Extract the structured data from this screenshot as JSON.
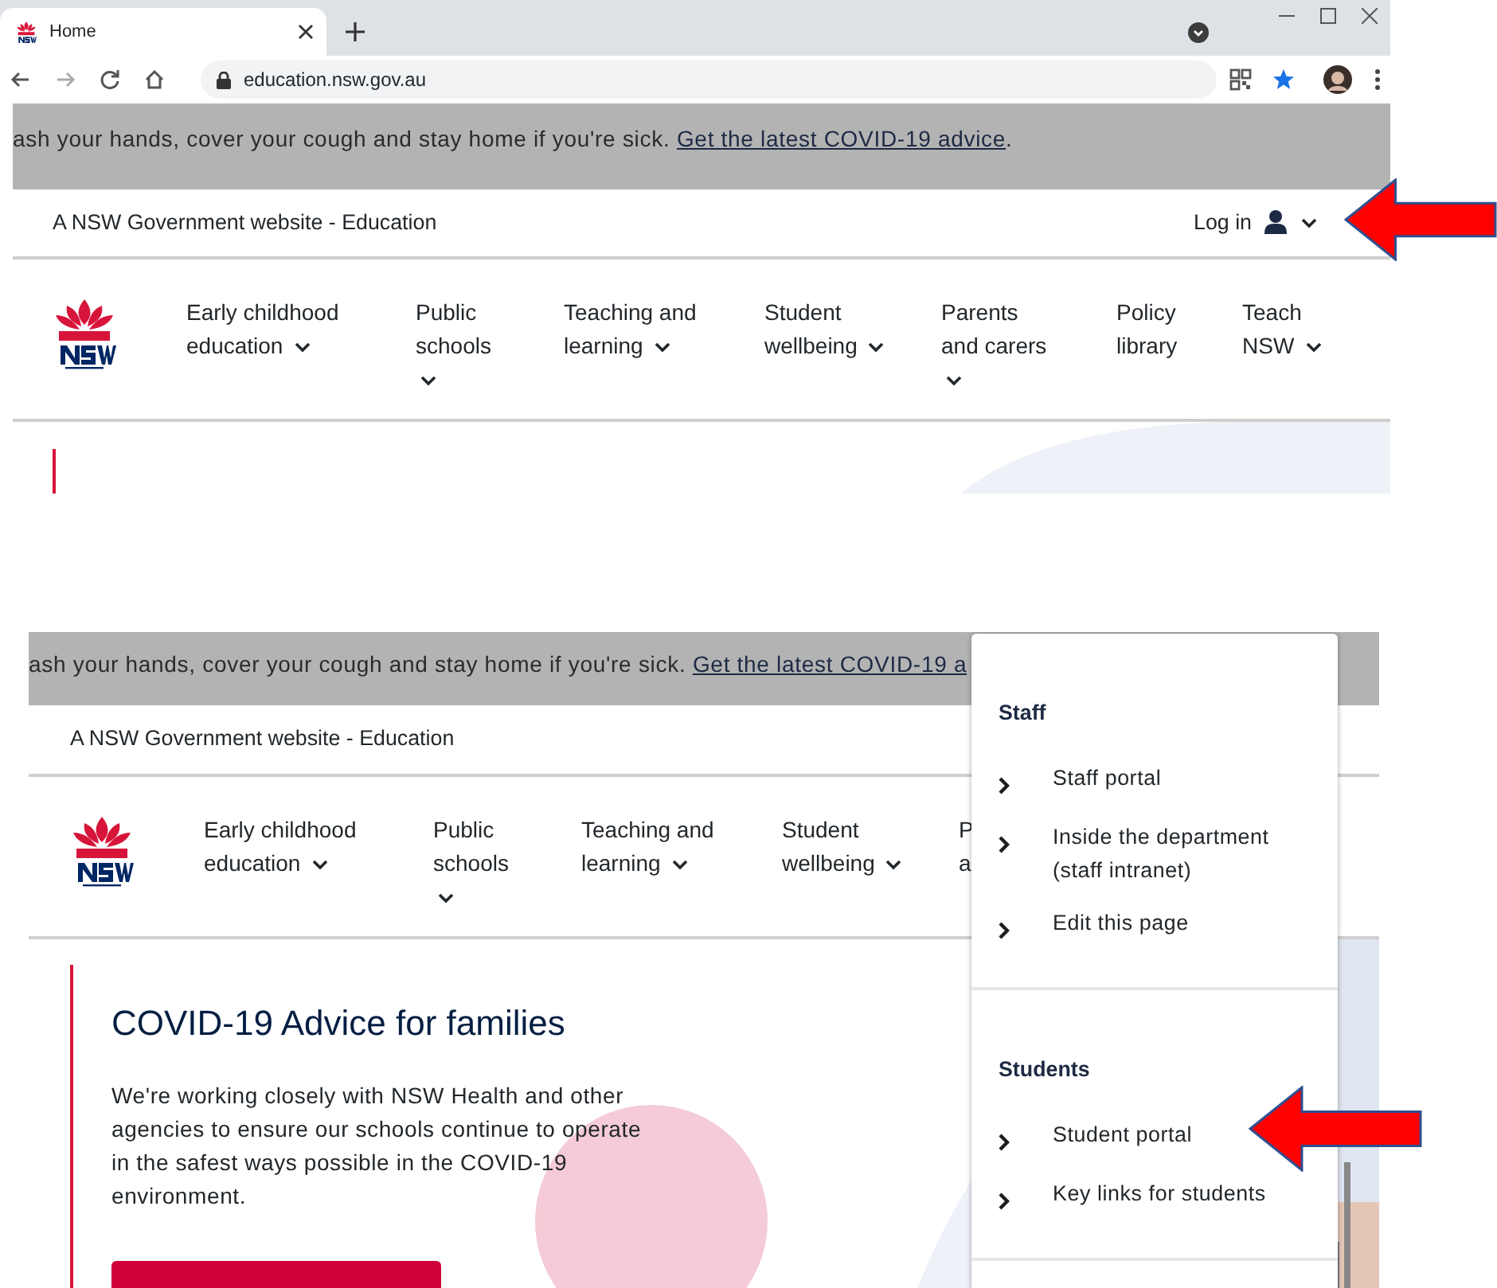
{
  "top_screenshot": {
    "browser": {
      "tab_title": "Home",
      "url": "education.nsw.gov.au"
    },
    "banner": {
      "text": "ash your hands, cover your cough and stay home if you're sick.",
      "link": "Get the latest COVID-19 advice",
      "after_link": "."
    },
    "header": {
      "site_title": "A NSW Government website - Education",
      "login": "Log in"
    },
    "nav": [
      {
        "label": "Early childhood education",
        "has_dropdown": true
      },
      {
        "label": "Public schools",
        "has_dropdown": true
      },
      {
        "label": "Teaching and learning",
        "has_dropdown": true
      },
      {
        "label": "Student wellbeing",
        "has_dropdown": true
      },
      {
        "label": "Parents and carers",
        "has_dropdown": true
      },
      {
        "label": "Policy library",
        "has_dropdown": false
      },
      {
        "label": "Teach NSW",
        "has_dropdown": true
      }
    ]
  },
  "bottom_screenshot": {
    "banner": {
      "text": "ash your hands, cover your cough and stay home if you're sick.",
      "link": "Get the latest COVID-19 a"
    },
    "header": {
      "site_title": "A NSW Government website - Education"
    },
    "nav": [
      {
        "label": "Early childhood education",
        "has_dropdown": true
      },
      {
        "label": "Public schools",
        "has_dropdown": true
      },
      {
        "label": "Teaching and learning",
        "has_dropdown": true
      },
      {
        "label": "Student wellbeing",
        "has_dropdown": true
      },
      {
        "label": "P a",
        "has_dropdown": false
      }
    ],
    "hero": {
      "heading": "COVID-19 Advice for families",
      "text": "We're working closely with NSW Health and other agencies to ensure our schools continue to operate in the safest ways possible in the COVID-19 environment."
    },
    "login_menu": {
      "sections": [
        {
          "heading": "Staff",
          "links": [
            "Staff portal",
            "Inside the department (staff intranet)",
            "Edit this page"
          ]
        },
        {
          "heading": "Students",
          "links": [
            "Student portal",
            "Key links for students"
          ]
        }
      ]
    }
  }
}
